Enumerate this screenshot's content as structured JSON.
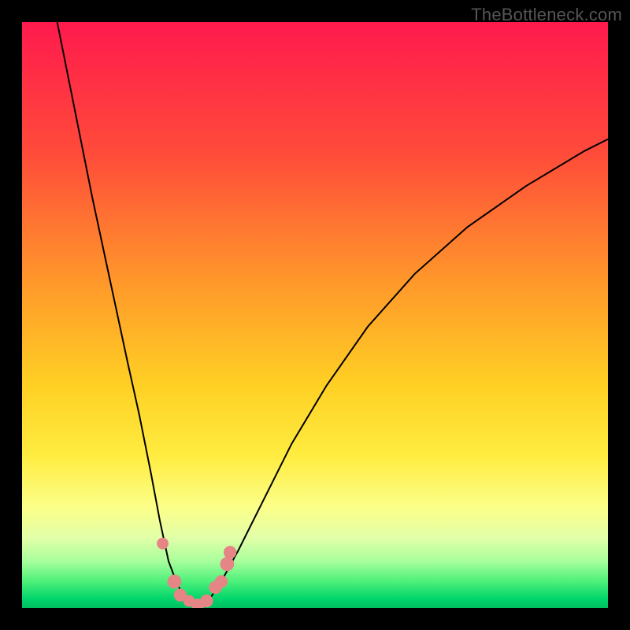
{
  "watermark": "TheBottleneck.com",
  "colors": {
    "gradient_stops": [
      {
        "offset": 0,
        "color": "#ff1a4d"
      },
      {
        "offset": 0.22,
        "color": "#ff4a3a"
      },
      {
        "offset": 0.45,
        "color": "#ff9a2a"
      },
      {
        "offset": 0.62,
        "color": "#ffd024"
      },
      {
        "offset": 0.74,
        "color": "#ffec40"
      },
      {
        "offset": 0.83,
        "color": "#fbff8a"
      },
      {
        "offset": 0.88,
        "color": "#e2ffa8"
      },
      {
        "offset": 0.92,
        "color": "#a8ff9c"
      },
      {
        "offset": 0.955,
        "color": "#4cf07a"
      },
      {
        "offset": 0.985,
        "color": "#00d46a"
      },
      {
        "offset": 1.0,
        "color": "#00c060"
      }
    ],
    "curve_stroke": "#000000",
    "marker_fill": "#e68585"
  },
  "chart_data": {
    "type": "line",
    "title": "",
    "xlabel": "",
    "ylabel": "",
    "xlim": [
      0,
      100
    ],
    "ylim": [
      0,
      100
    ],
    "curves": {
      "left": [
        {
          "x": 6,
          "y": 100
        },
        {
          "x": 9,
          "y": 85
        },
        {
          "x": 12,
          "y": 70
        },
        {
          "x": 15,
          "y": 56
        },
        {
          "x": 18,
          "y": 42
        },
        {
          "x": 20,
          "y": 33
        },
        {
          "x": 22,
          "y": 23
        },
        {
          "x": 23.5,
          "y": 15
        },
        {
          "x": 25,
          "y": 8
        },
        {
          "x": 26.5,
          "y": 4
        },
        {
          "x": 28,
          "y": 1.5
        },
        {
          "x": 30,
          "y": 0.5
        }
      ],
      "right": [
        {
          "x": 30,
          "y": 0.5
        },
        {
          "x": 32,
          "y": 1.5
        },
        {
          "x": 34,
          "y": 4.5
        },
        {
          "x": 37,
          "y": 10
        },
        {
          "x": 41,
          "y": 18
        },
        {
          "x": 46,
          "y": 28
        },
        {
          "x": 52,
          "y": 38
        },
        {
          "x": 59,
          "y": 48
        },
        {
          "x": 67,
          "y": 57
        },
        {
          "x": 76,
          "y": 65
        },
        {
          "x": 86,
          "y": 72
        },
        {
          "x": 96,
          "y": 78
        },
        {
          "x": 100,
          "y": 80
        }
      ]
    },
    "markers": [
      {
        "x": 24,
        "y": 11,
        "r": 1.0
      },
      {
        "x": 26,
        "y": 4.5,
        "r": 1.2
      },
      {
        "x": 27,
        "y": 2.2,
        "r": 1.1
      },
      {
        "x": 28.5,
        "y": 1.2,
        "r": 1.0
      },
      {
        "x": 30,
        "y": 0.5,
        "r": 1.1
      },
      {
        "x": 31.5,
        "y": 1.2,
        "r": 1.1
      },
      {
        "x": 33,
        "y": 3.5,
        "r": 1.1
      },
      {
        "x": 34,
        "y": 4.5,
        "r": 1.1
      },
      {
        "x": 35,
        "y": 7.5,
        "r": 1.2
      },
      {
        "x": 35.5,
        "y": 9.5,
        "r": 1.1
      }
    ]
  }
}
